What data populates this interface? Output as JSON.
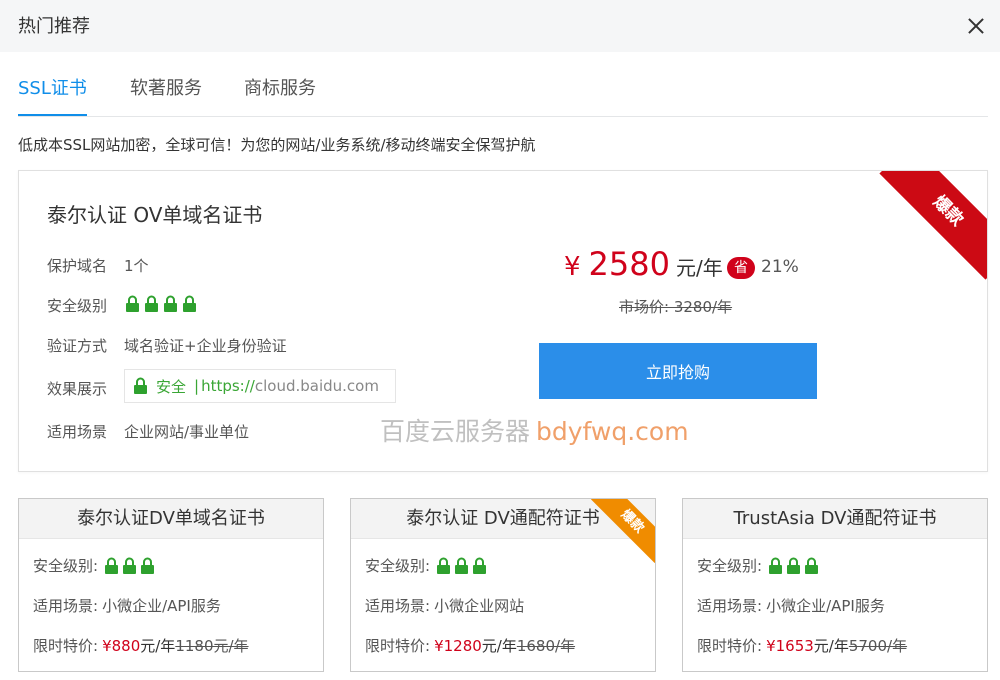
{
  "header": {
    "title": "热门推荐"
  },
  "tabs": [
    {
      "label": "SSL证书",
      "active": true
    },
    {
      "label": "软著服务",
      "active": false
    },
    {
      "label": "商标服务",
      "active": false
    }
  ],
  "intro": "低成本SSL网站加密，全球可信！为您的网站/业务系统/移动终端安全保驾护航",
  "main_card": {
    "title": "泰尔认证 OV单域名证书",
    "rows": {
      "domains_label": "保护域名",
      "domains_value": "1个",
      "security_label": "安全级别",
      "security_locks": 4,
      "verify_label": "验证方式",
      "verify_value": "域名验证+企业身份验证",
      "effect_label": "效果展示",
      "effect_secure": "安全",
      "effect_sep": "|",
      "effect_proto": "https://",
      "effect_domain": "cloud.baidu.com",
      "scene_label": "适用场景",
      "scene_value": "企业网站/事业单位"
    },
    "price": {
      "currency": "¥",
      "value": "2580",
      "unit": "元/年",
      "save_badge": "省",
      "save_pct": "21%",
      "market": "市场价: 3280/年"
    },
    "buy_label": "立即抢购",
    "ribbon": "爆款"
  },
  "watermark": {
    "cn": "百度云服务器",
    "en": "bdyfwq.com"
  },
  "small_cards": [
    {
      "title": "泰尔认证DV单域名证书",
      "security_label": "安全级别:",
      "locks": 3,
      "scene_label": "适用场景:",
      "scene_value": "小微企业/API服务",
      "price_label": "限时特价:",
      "price": "¥880",
      "unit": "元/年",
      "old_price": "1180元/年",
      "ribbon": ""
    },
    {
      "title": "泰尔认证 DV通配符证书",
      "security_label": "安全级别:",
      "locks": 3,
      "scene_label": "适用场景:",
      "scene_value": "小微企业网站",
      "price_label": "限时特价:",
      "price": "¥1280",
      "unit": "元/年",
      "old_price": "1680/年",
      "ribbon": "爆款"
    },
    {
      "title": "TrustAsia DV通配符证书",
      "security_label": "安全级别:",
      "locks": 3,
      "scene_label": "适用场景:",
      "scene_value": "小微企业/API服务",
      "price_label": "限时特价:",
      "price": "¥1653",
      "unit": "元/年",
      "old_price": "5700/年",
      "ribbon": ""
    }
  ],
  "colors": {
    "accent": "#108ee9",
    "button": "#2b8ee9",
    "price_red": "#d0021b",
    "lock_green": "#2ea12e",
    "ribbon_red": "#cc0a14",
    "ribbon_orange": "#f08c00"
  },
  "icons": {
    "close": "close-icon",
    "lock": "lock-icon"
  }
}
